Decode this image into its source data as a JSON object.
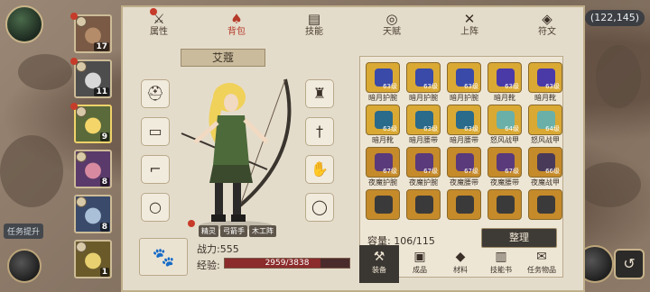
{
  "coord": "(122,145)",
  "task_tag": "任务提升",
  "heroes": [
    {
      "level": "17",
      "bg": "#7a5a45",
      "skin": "#b48c6a"
    },
    {
      "level": "11",
      "bg": "#4d4d4d",
      "skin": "#d8d8d8"
    },
    {
      "level": "9",
      "bg": "#5a6a3a",
      "skin": "#f3d56a",
      "selected": true
    },
    {
      "level": "8",
      "bg": "#5a3a6a",
      "skin": "#d88aa0"
    },
    {
      "level": "8",
      "bg": "#3a4a6a",
      "skin": "#a9c0d8"
    },
    {
      "level": "1",
      "bg": "#6a5a2a",
      "skin": "#e8d070"
    }
  ],
  "tabs": [
    {
      "label": "属性",
      "icon": "⚔",
      "active": false
    },
    {
      "label": "背包",
      "icon": "♠",
      "active": true
    },
    {
      "label": "技能",
      "icon": "▤",
      "active": false
    },
    {
      "label": "天赋",
      "icon": "◎",
      "active": false
    },
    {
      "label": "上阵",
      "icon": "✕",
      "active": false
    },
    {
      "label": "符文",
      "icon": "◈",
      "active": false
    }
  ],
  "hero_name": "艾蔻",
  "tags": [
    "精灵",
    "弓箭手",
    "木工阵"
  ],
  "power": "战力:555",
  "exp_label": "经验:",
  "exp": {
    "current": 2959,
    "max": 3838,
    "text": "2959/3838"
  },
  "left_slots": [
    "helmet-icon",
    "belt-icon",
    "boots-icon",
    "ring-icon"
  ],
  "right_slots": [
    "armor-icon",
    "sword-icon",
    "glove-icon",
    "necklace-icon"
  ],
  "items": [
    {
      "name": "暗月护腕",
      "lv": "63级",
      "color": "#3a4aa8"
    },
    {
      "name": "暗月护腕",
      "lv": "63级",
      "color": "#3a4aa8"
    },
    {
      "name": "暗月护腕",
      "lv": "63级",
      "color": "#3a4aa8"
    },
    {
      "name": "暗月靴",
      "lv": "63级",
      "color": "#4a3aa8"
    },
    {
      "name": "暗月靴",
      "lv": "63级",
      "color": "#4a3aa8"
    },
    {
      "name": "暗月靴",
      "lv": "63级",
      "color": "#2a6a8a"
    },
    {
      "name": "暗月腰带",
      "lv": "63级",
      "color": "#2a6a8a"
    },
    {
      "name": "暗月腰带",
      "lv": "63级",
      "color": "#2a6a8a"
    },
    {
      "name": "怒风战甲",
      "lv": "64级",
      "color": "#6ab0a8"
    },
    {
      "name": "怒风战甲",
      "lv": "64级",
      "color": "#6ab0a8"
    },
    {
      "name": "夜魔护腕",
      "lv": "67级",
      "color": "#5a3a7a"
    },
    {
      "name": "夜魔护腕",
      "lv": "67级",
      "color": "#5a3a7a"
    },
    {
      "name": "夜魔腰带",
      "lv": "67级",
      "color": "#5a3a7a"
    },
    {
      "name": "夜魔腰带",
      "lv": "67级",
      "color": "#5a3a7a"
    },
    {
      "name": "夜魔战甲",
      "lv": "66级",
      "color": "#4a3a5a"
    },
    {
      "name": "",
      "lv": "",
      "color": "#3a3a3a"
    },
    {
      "name": "",
      "lv": "",
      "color": "#3a3a3a"
    },
    {
      "name": "",
      "lv": "",
      "color": "#3a3a3a"
    },
    {
      "name": "",
      "lv": "",
      "color": "#3a3a3a"
    },
    {
      "name": "",
      "lv": "",
      "color": "#3a3a3a"
    }
  ],
  "capacity_label": "容量:",
  "capacity_value": "106/115",
  "organize_label": "整理",
  "bottom_tabs": [
    {
      "label": "装备",
      "icon": "⚒",
      "active": true
    },
    {
      "label": "成品",
      "icon": "▣",
      "active": false
    },
    {
      "label": "材料",
      "icon": "◆",
      "active": false
    },
    {
      "label": "技能书",
      "icon": "▥",
      "active": false
    },
    {
      "label": "任务物品",
      "icon": "✉",
      "active": false
    }
  ]
}
